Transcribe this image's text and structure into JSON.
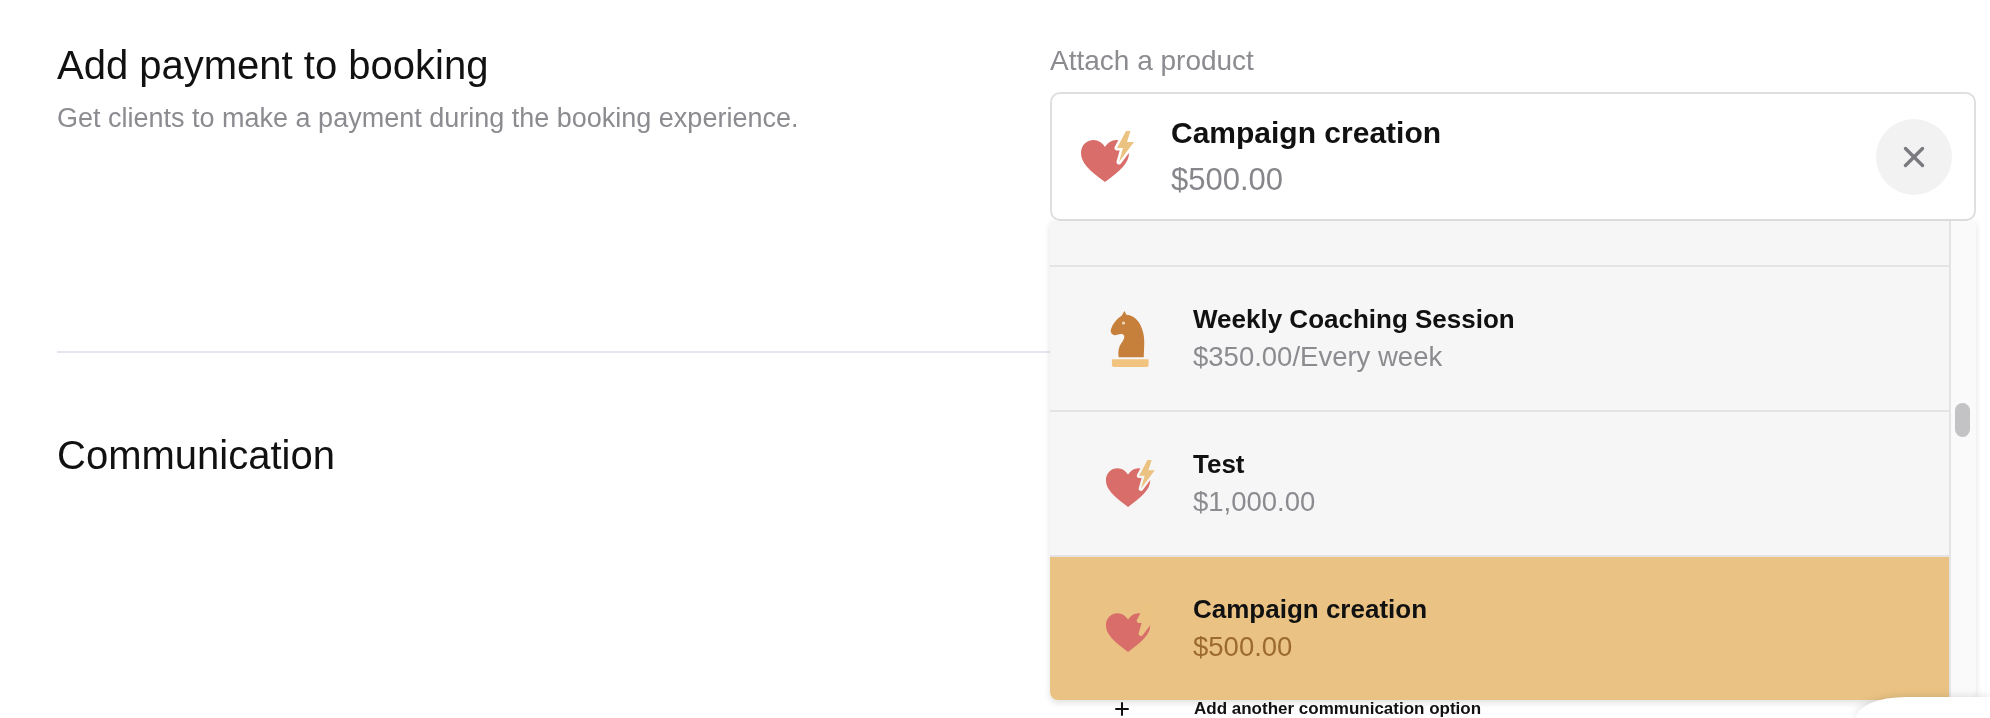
{
  "payment_section": {
    "title": "Add payment to booking",
    "description": "Get clients to make a payment during the booking experience."
  },
  "product_picker": {
    "label": "Attach a product",
    "selected_product": {
      "kind": "heart",
      "name": "Campaign creation",
      "price": "$500.00"
    },
    "options": [
      {
        "kind": "knight",
        "name": "Weekly Coaching Session",
        "price": "$350.00/Every week",
        "selected": false
      },
      {
        "kind": "heart",
        "name": "Test",
        "price": "$1,000.00",
        "selected": false
      },
      {
        "kind": "heart",
        "name": "Campaign creation",
        "price": "$500.00",
        "selected": true
      }
    ]
  },
  "communication_section": {
    "title": "Communication",
    "add_button": {
      "label": "Add another communication option"
    }
  }
}
